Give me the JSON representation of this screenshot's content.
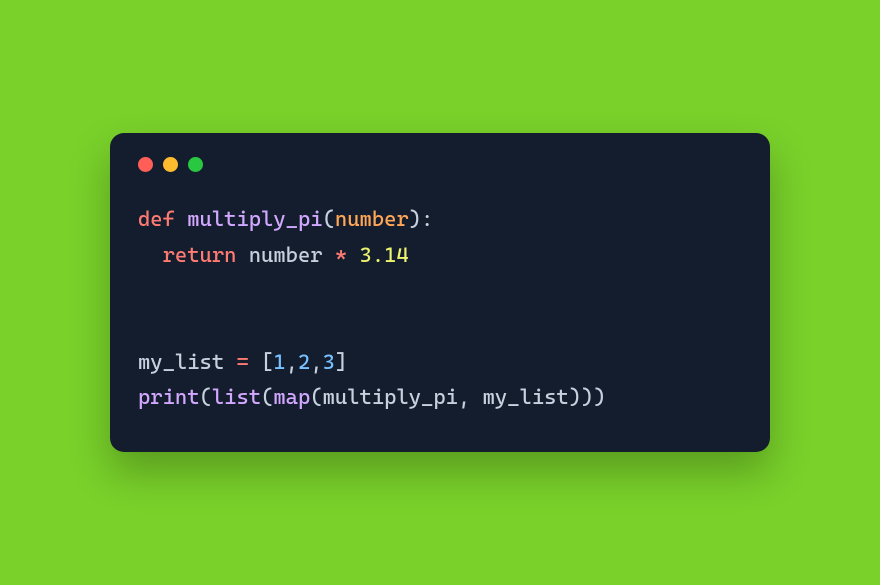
{
  "window": {
    "buttons": {
      "close": "close",
      "minimize": "minimize",
      "maximize": "maximize"
    }
  },
  "code": {
    "line1": {
      "def": "def",
      "fn": "multiply_pi",
      "lp": "(",
      "param": "number",
      "rp": ")",
      "colon": ":"
    },
    "line2": {
      "indent": "  ",
      "return": "return",
      "sp": " ",
      "ident": "number",
      "sp2": " ",
      "op": "*",
      "sp3": " ",
      "num": "3.14"
    },
    "line3": "",
    "line4": "",
    "line5": {
      "ident": "my_list",
      "sp": " ",
      "eq": "=",
      "sp2": " ",
      "lb": "[",
      "n1": "1",
      "c1": ",",
      "n2": "2",
      "c2": ",",
      "n3": "3",
      "rb": "]"
    },
    "line6": {
      "print": "print",
      "lp1": "(",
      "list": "list",
      "lp2": "(",
      "map": "map",
      "lp3": "(",
      "arg1": "multiply_pi",
      "comma": ",",
      "sp": " ",
      "arg2": "my_list",
      "rp3": ")",
      "rp2": ")",
      "rp1": ")"
    }
  }
}
